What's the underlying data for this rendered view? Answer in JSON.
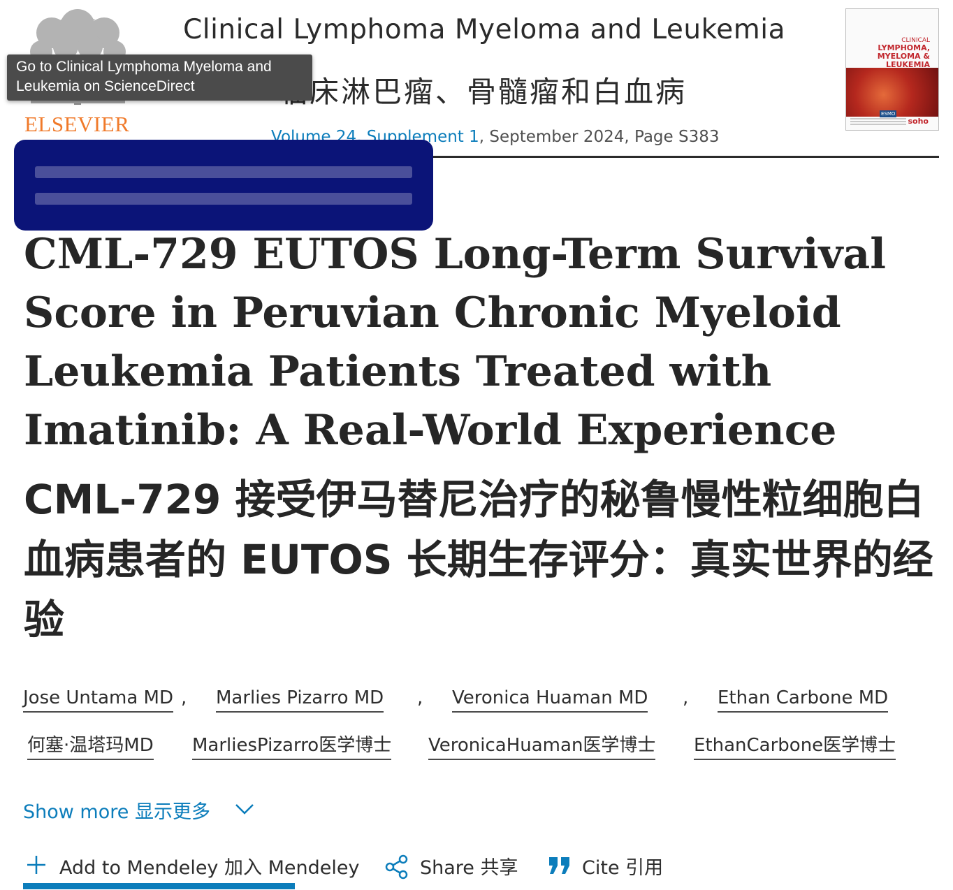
{
  "header": {
    "publisher": "ELSEVIER",
    "journal_title": "Clinical Lymphoma Myeloma and Leukemia",
    "journal_title_cn": "临床淋巴瘤、骨髓瘤和白血病",
    "issue_link": "Volume 24, Supplement 1",
    "issue_rest": ", September 2024, Page S383",
    "cover": {
      "line1": "CLINICAL",
      "line2": "LYMPHOMA,",
      "line3": "MYELOMA & LEUKEMIA",
      "badge": "ESMO",
      "brand": "soho"
    }
  },
  "tooltip": {
    "text": "Go to Clinical Lymphoma Myeloma and Leukemia on ScienceDirect"
  },
  "article": {
    "title_en": "CML-729 EUTOS Long-Term Survival Score in Peruvian Chronic Myeloid Leukemia Patients Treated with Imatinib: A Real-World Experience",
    "title_cn": "CML-729 接受伊马替尼治疗的秘鲁慢性粒细胞白血病患者的 EUTOS 长期生存评分：真实世界的经验"
  },
  "authors": {
    "en": [
      "Jose Untama MD",
      "Marlies Pizarro MD",
      "Veronica Huaman MD",
      "Ethan Carbone MD"
    ],
    "cn": [
      "何塞·温塔玛MD",
      "MarliesPizarro医学博士",
      "VeronicaHuaman医学博士",
      "EthanCarbone医学博士"
    ],
    "separator": ","
  },
  "show_more": {
    "label": "Show more 显示更多"
  },
  "actions": {
    "mendeley": "Add to Mendeley 加入 Mendeley",
    "share": "Share 共享",
    "cite": "Cite 引用"
  },
  "colors": {
    "link": "#0c7dbb",
    "elsevier_orange": "#f07a2a",
    "redaction": "#0b1478"
  }
}
